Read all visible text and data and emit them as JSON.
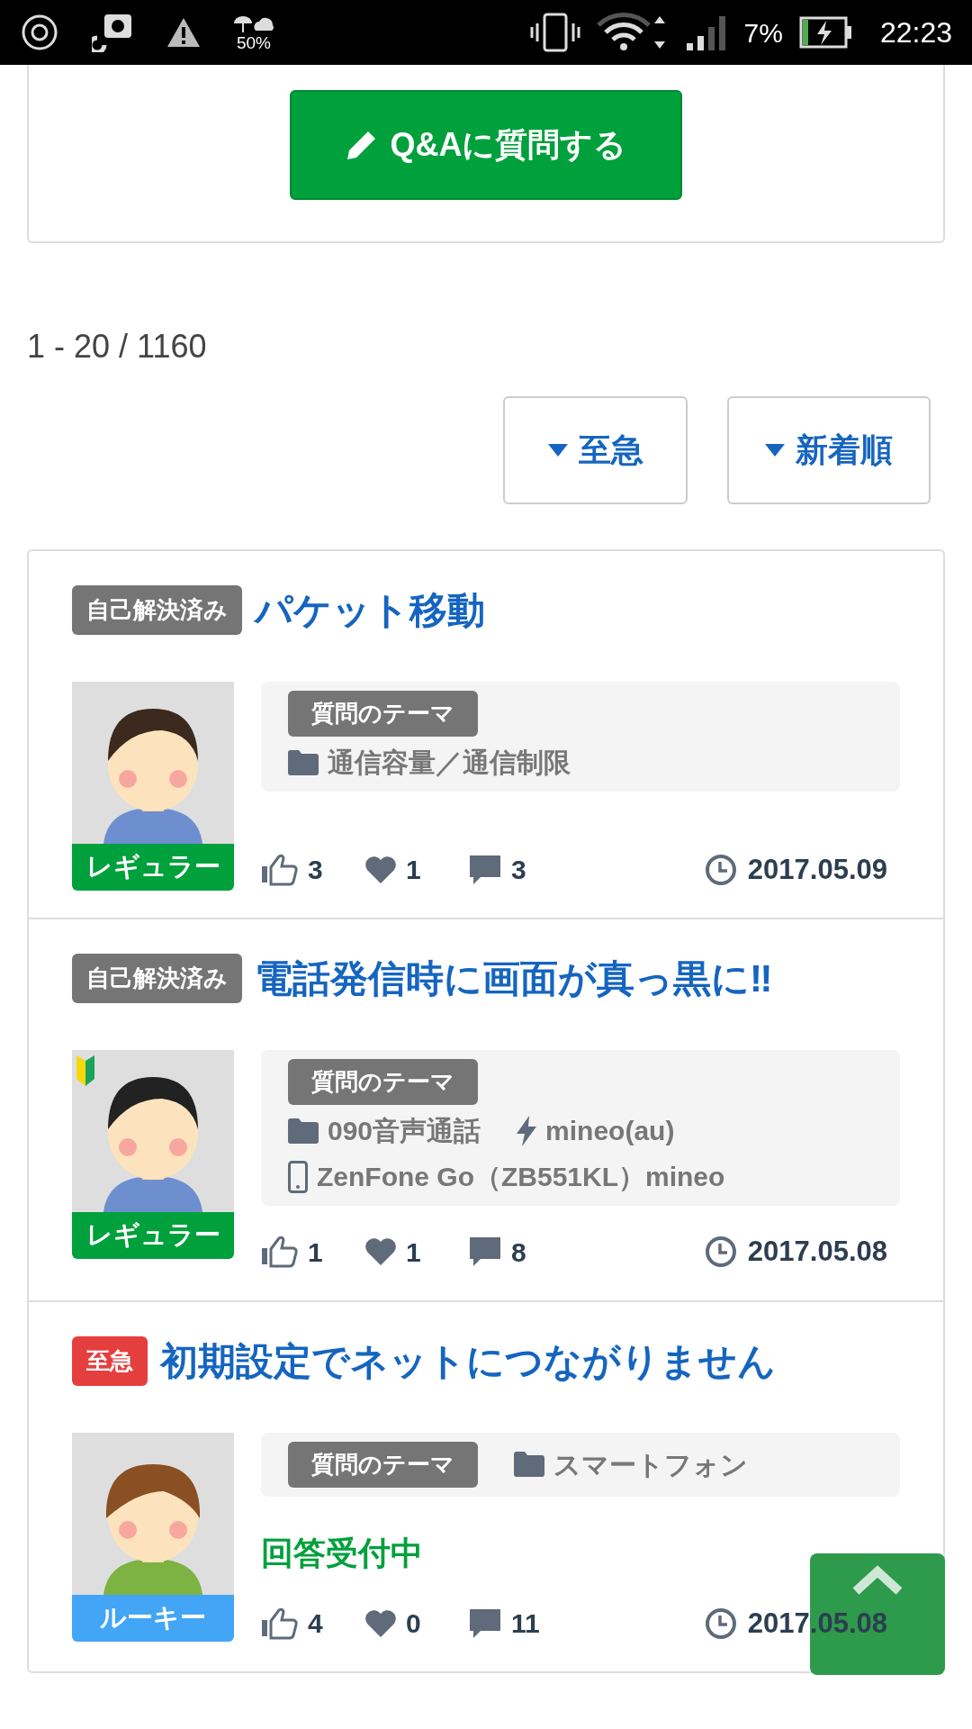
{
  "status_bar": {
    "weather_percent": "50%",
    "battery_percent": "7%",
    "time": "22:23"
  },
  "ask_button": {
    "label": "Q&Aに質問する"
  },
  "result_count": "1 - 20 / 1160",
  "filters": [
    {
      "label": "至急"
    },
    {
      "label": "新着順"
    }
  ],
  "questions": [
    {
      "badge": {
        "kind": "solved",
        "label": "自己解決済み"
      },
      "title": "パケット移動",
      "avatar": {
        "kind": "male_short",
        "beginner": false,
        "rank": {
          "label": "レギュラー",
          "color": "#00a03c"
        }
      },
      "theme": {
        "kind": "stacked",
        "label": "質問のテーマ",
        "tags": [
          {
            "kind": "folder",
            "text": "通信容量／通信制限"
          }
        ]
      },
      "likes": "3",
      "favorites": "1",
      "comments": "3",
      "date": "2017.05.09"
    },
    {
      "badge": {
        "kind": "solved",
        "label": "自己解決済み"
      },
      "title": "電話発信時に画面が真っ黒に‼",
      "avatar": {
        "kind": "male_long",
        "beginner": true,
        "rank": {
          "label": "レギュラー",
          "color": "#00a03c"
        }
      },
      "theme": {
        "kind": "stacked",
        "label": "質問のテーマ",
        "tags": [
          {
            "kind": "folder",
            "text": "090音声通話"
          },
          {
            "kind": "bolt",
            "text": "mineo(au)"
          },
          {
            "kind": "phone",
            "text": "ZenFone Go（ZB551KL）mineo"
          }
        ]
      },
      "likes": "1",
      "favorites": "1",
      "comments": "8",
      "date": "2017.05.08"
    },
    {
      "badge": {
        "kind": "urgent",
        "label": "至急"
      },
      "title": "初期設定でネットにつながりません",
      "avatar": {
        "kind": "female",
        "beginner": false,
        "rank": {
          "label": "ルーキー",
          "color": "#42a5f5"
        }
      },
      "theme": {
        "kind": "inline",
        "label": "質問のテーマ",
        "tags": [
          {
            "kind": "folder",
            "text": "スマートフォン"
          }
        ]
      },
      "status": "回答受付中",
      "likes": "4",
      "favorites": "0",
      "comments": "11",
      "date": "2017.05.08"
    }
  ]
}
